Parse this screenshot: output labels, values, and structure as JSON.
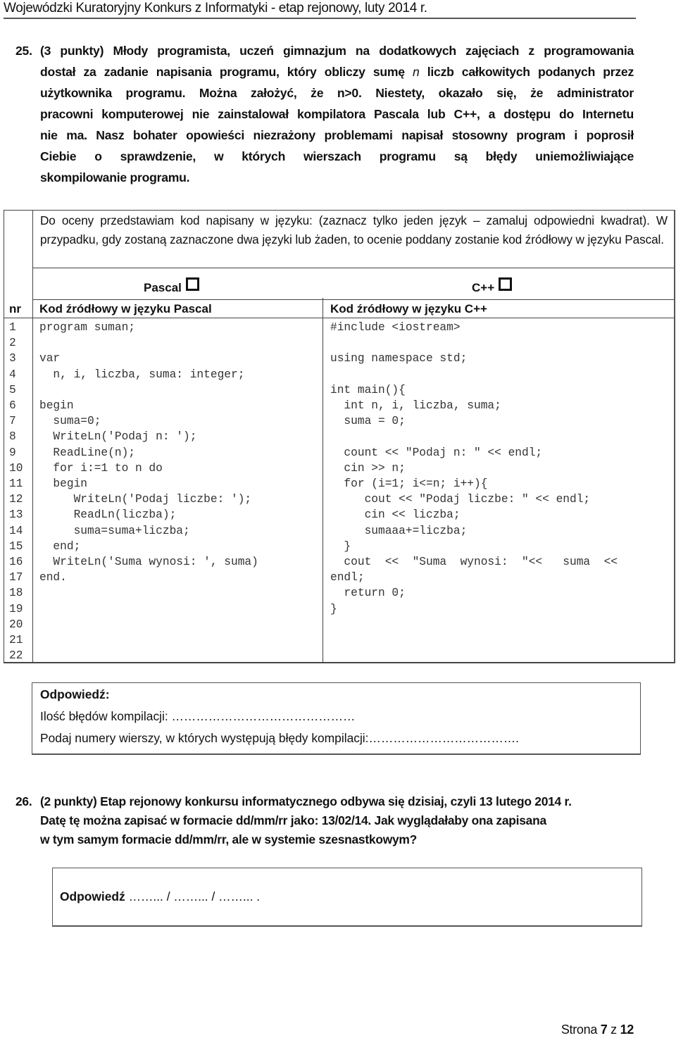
{
  "header": {
    "title": "Wojewódzki Kuratoryjny Konkurs z Informatyki - etap rejonowy, luty 2014 r."
  },
  "task25": {
    "number": "25.",
    "lines": [
      "(3 punkty) Młody programista, uczeń gimnazjum na dodatkowych zajęciach z programowania",
      "dostał za zadanie napisania programu, który obliczy sumę n liczb całkowitych podanych przez",
      "użytkownika programu. Można założyć, że n>0. Niestety, okazało się, że administrator",
      "pracowni komputerowej nie zainstalował kompilatora Pascala lub C++, a dostępu do Internetu",
      "nie ma. Nasz bohater opowieści niezrażony problemami napisał stosowny program i poprosił",
      "Ciebie o sprawdzenie, w których wierszach programu są błędy uniemożliwiające",
      "skompilowanie programu."
    ]
  },
  "table": {
    "instruction": "Do oceny przedstawiam kod napisany w języku: (zaznacz tylko jeden język – zamaluj odpowiedni kwadrat). W przypadku, gdy zostaną zaznaczone dwa języki lub żaden, to ocenie poddany zostanie kod źródłowy w języku Pascal.",
    "languages": [
      {
        "label": "Pascal",
        "checked": false
      },
      {
        "label": "C++",
        "checked": false
      }
    ],
    "headers": {
      "nr": "nr",
      "pascal": "Kod źródłowy w języku Pascal",
      "cpp": "Kod źródłowy w języku C++"
    },
    "line_numbers": [
      "1",
      "2",
      "3",
      "4",
      "5",
      "6",
      "7",
      "8",
      "9",
      "10",
      "11",
      "12",
      "13",
      "14",
      "15",
      "16",
      "17",
      "18",
      "19",
      "20",
      "21",
      "22"
    ],
    "pascal_code": [
      "program suman;",
      "",
      "var",
      "  n, i, liczba, suma: integer;",
      "",
      "begin",
      "  suma=0;",
      "  WriteLn('Podaj n: ');",
      "  ReadLine(n);",
      "  for i:=1 to n do",
      "  begin",
      "     WriteLn('Podaj liczbe: ');",
      "     ReadLn(liczba);",
      "     suma=suma+liczba;",
      "  end;",
      "  WriteLn('Suma wynosi: ', suma)",
      "end.",
      "",
      "",
      "",
      "",
      ""
    ],
    "cpp_code": [
      "#include <iostream>",
      "",
      "using namespace std;",
      "",
      "int main(){",
      "  int n, i, liczba, suma;",
      "  suma = 0;",
      "",
      "  count << \"Podaj n: \" << endl;",
      "  cin >> n;",
      "  for (i=1; i<=n; i++){",
      "     cout << \"Podaj liczbe: \" << endl;",
      "     cin << liczba;",
      "     sumaaa+=liczba;",
      "  }",
      "  cout  <<  \"Suma  wynosi:  \"<<   suma  <<",
      "endl;",
      "  return 0;",
      "}",
      "",
      "",
      ""
    ]
  },
  "answer25": {
    "title": "Odpowiedź:",
    "errors_count_label": "Ilość błędów kompilacji: ………………………………………",
    "error_lines_label": "Podaj numery wierszy, w których występują błędy kompilacji:………………………………."
  },
  "task26": {
    "number": "26.",
    "lines": [
      "(2 punkty) Etap rejonowy konkursu informatycznego odbywa się dzisiaj, czyli 13 lutego 2014 r.",
      "Datę tę można zapisać w formacie dd/mm/rr jako: 13/02/14. Jak wyglądałaby ona zapisana",
      "w tym samym formacie dd/mm/rr, ale w systemie szesnastkowym?"
    ]
  },
  "answer26": {
    "title": "Odpowiedź",
    "blanks": "……... / ……... / ……... ."
  },
  "footer": {
    "prefix": "Strona ",
    "page": "7",
    "sep": " z ",
    "total": "12"
  }
}
